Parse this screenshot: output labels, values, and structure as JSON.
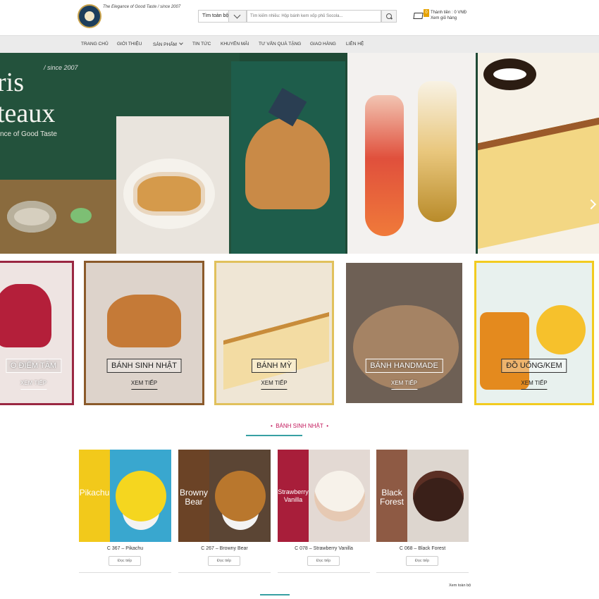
{
  "header": {
    "slogan": "The Elegance of Good Taste / since 2007",
    "search_category": "Tìm toàn bộ",
    "search_placeholder": "Tìm kiếm nhiều: Hộp bánh kem xốp phủ Socola...",
    "cart_count": "0",
    "cart_total": "Thành tiền : 0 VNĐ",
    "cart_view": "Xem giỏ hàng"
  },
  "nav": [
    "Trang chủ",
    "Giới thiệu",
    "Sản phẩm",
    "Tin tức",
    "Khuyến mãi",
    "Tư vấn quà tặng",
    "Giao hàng",
    "Liên hệ"
  ],
  "banner": {
    "line1": "ris",
    "since": "/ since 2007",
    "line2": "teaux",
    "line3": "nce of Good Taste"
  },
  "categories": [
    {
      "label": "O ĐIỂM TÂM",
      "more": "XEM TIẾP"
    },
    {
      "label": "BÁNH SINH NHẬT",
      "more": "XEM TIẾP"
    },
    {
      "label": "BÁNH MỲ",
      "more": "XEM TIẾP"
    },
    {
      "label": "BÁNH HANDMADE",
      "more": "XEM TIẾP"
    },
    {
      "label": "ĐỒ UỐNG/KEM",
      "more": "XEM TIẾP"
    }
  ],
  "section": {
    "title": "BÁNH SINH NHẬT"
  },
  "products": [
    {
      "overlay": "Pikachu",
      "caption": "C 367 – Pikachu",
      "button": "Đọc tiếp"
    },
    {
      "overlay": "Browny Bear",
      "caption": "C 267 – Browny Bear",
      "button": "Đọc tiếp"
    },
    {
      "overlay": "Strawberry Vanilla",
      "caption": "C 078 – Strawberry Vanilla",
      "button": "Đọc tiếp"
    },
    {
      "overlay": "Black Forest",
      "caption": "C 068 – Black Forest",
      "button": "Đọc tiếp"
    }
  ],
  "view_all": "Xem toàn bộ",
  "colors": {
    "accent": "#37a0a3",
    "title": "#c2185b",
    "nav_bg": "#ebebeb"
  }
}
